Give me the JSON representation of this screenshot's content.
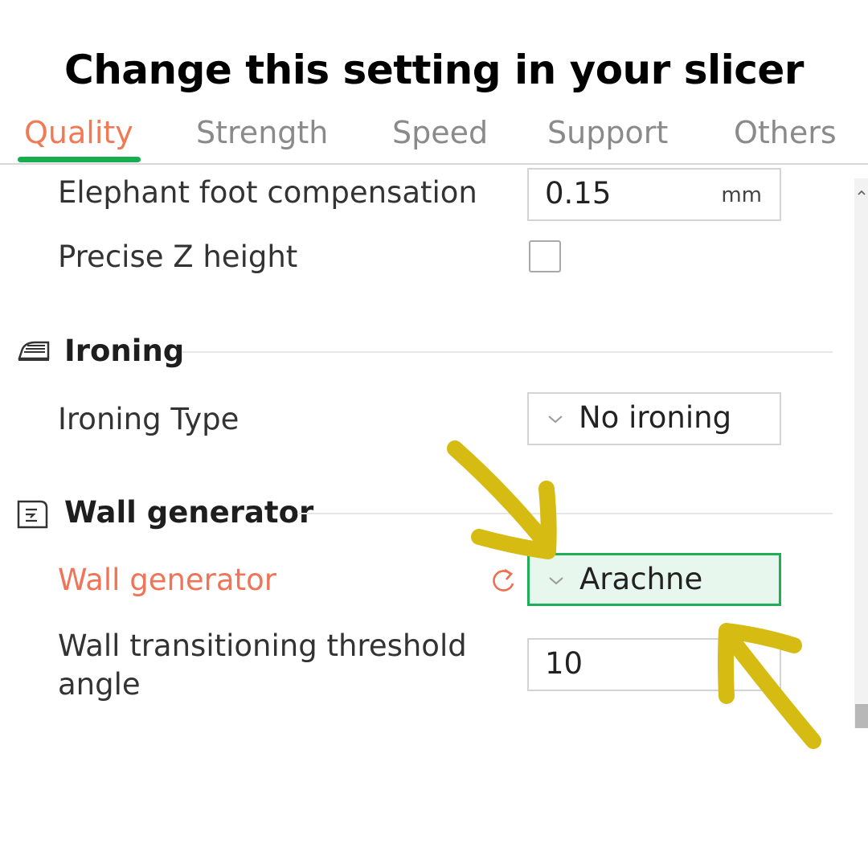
{
  "headline": "Change this setting in your slicer",
  "tabs": [
    {
      "label": "Quality",
      "active": true
    },
    {
      "label": "Strength",
      "active": false
    },
    {
      "label": "Speed",
      "active": false
    },
    {
      "label": "Support",
      "active": false
    },
    {
      "label": "Others",
      "active": false
    }
  ],
  "settings": {
    "elephant_foot": {
      "label": "Elephant foot compensation",
      "value": "0.15",
      "unit": "mm"
    },
    "precise_z": {
      "label": "Precise Z height",
      "checked": false
    }
  },
  "ironing": {
    "title": "Ironing",
    "icon": "iron-icon",
    "type": {
      "label": "Ironing Type",
      "value": "No ironing"
    }
  },
  "wall_generator_section": {
    "title": "Wall generator",
    "icon": "wall-generator-icon",
    "generator": {
      "label": "Wall generator",
      "value": "Arachne",
      "modified": true
    },
    "threshold": {
      "label_line1": "Wall transitioning threshold",
      "label_line2": "angle",
      "value": "10"
    }
  },
  "colors": {
    "accent_active_tab": "#f07a56",
    "tab_underline": "#18ad4f",
    "modified_label": "#ef7558",
    "highlight_border": "#1eae55",
    "highlight_fill": "#e8f7ee",
    "annotation_arrow": "#d6bc12"
  },
  "annotations": [
    "arrow-pointing-down-left",
    "arrow-pointing-up-left"
  ]
}
